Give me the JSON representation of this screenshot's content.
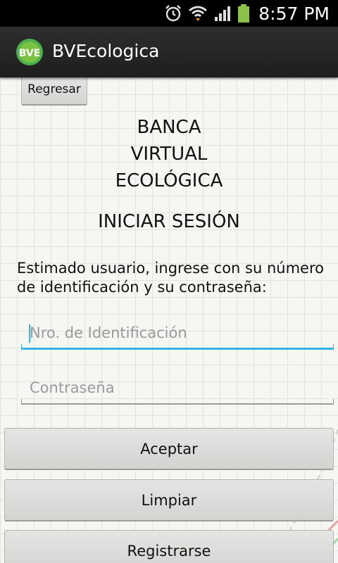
{
  "status_bar": {
    "time": "8:57 PM",
    "icons": [
      "alarm-icon",
      "wifi-icon",
      "signal-icon",
      "battery-icon"
    ],
    "battery_color": "#8bc34a"
  },
  "action_bar": {
    "title": "BVEcologica",
    "logo_text": "BVE",
    "logo_color": "#4caf50"
  },
  "content": {
    "back_button": "Regresar",
    "bank_title": [
      "BANCA",
      "VIRTUAL",
      "ECOLÓGICA"
    ],
    "login_title": "INICIAR SESIÓN",
    "instructions": "Estimado usuario, ingrese con su número de identificación y su contraseña:",
    "id_field": {
      "placeholder": "Nro. de Identificación",
      "focused": true
    },
    "password_field": {
      "placeholder": "Contraseña"
    },
    "accept_button": "Aceptar",
    "clear_button": "Limpiar",
    "register_button": "Registrarse"
  },
  "colors": {
    "focus_accent": "#33b5e5",
    "background": "#f6f6f3"
  }
}
